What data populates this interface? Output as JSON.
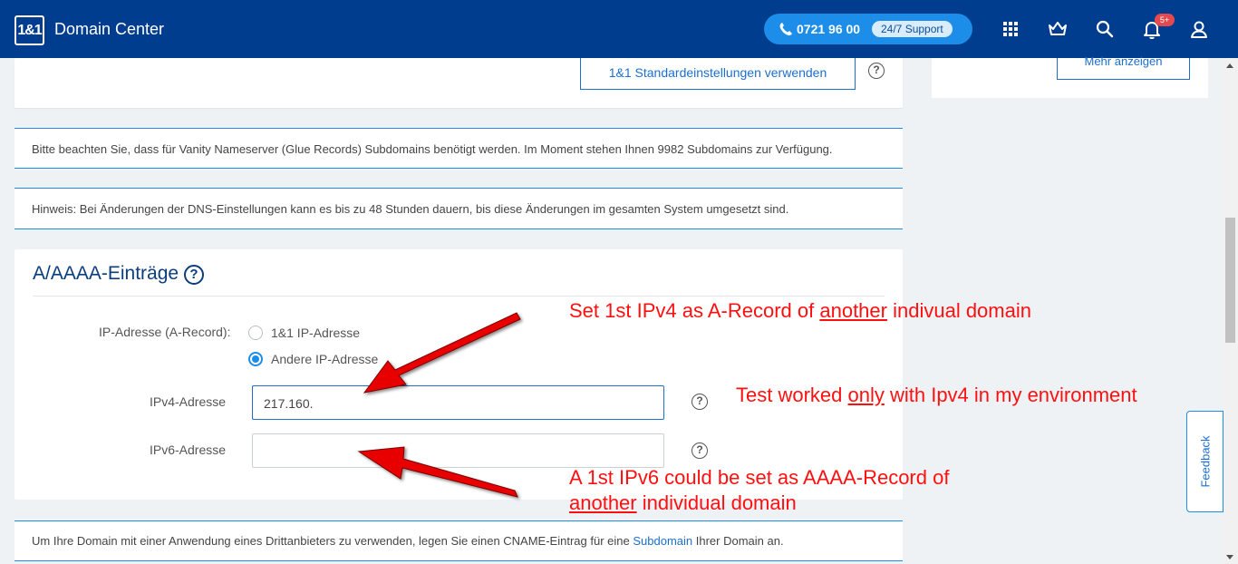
{
  "header": {
    "logo": "1&1",
    "title": "Domain Center",
    "phone": "0721 96 00",
    "support": "24/7 Support",
    "notifications_badge": "5+"
  },
  "top_card": {
    "default_settings_button": "1&1 Standardeinstellungen verwenden",
    "help": "?"
  },
  "side_card": {
    "more_button": "Mehr anzeigen"
  },
  "notices": {
    "glue": "Bitte beachten Sie, dass für Vanity Nameserver (Glue Records) Subdomains benötigt werden. Im Moment stehen Ihnen 9982 Subdomains zur Verfügung.",
    "dns_hint": "Hinweis: Bei Änderungen der DNS-Einstellungen kann es bis zu 48 Stunden dauern, bis diese Änderungen im gesamten System umgesetzt sind.",
    "cname_text": "Um Ihre Domain mit einer Anwendung eines Drittanbieters zu verwenden, legen Sie einen CNAME-Eintrag für eine",
    "cname_link": "Subdomain",
    "cname_suffix": "Ihrer Domain an."
  },
  "a_section": {
    "title": "A/AAAA-Einträge",
    "title_help": "?",
    "ip_label": "IP-Adresse (A-Record):",
    "radio_options": [
      {
        "label": "1&1 IP-Adresse",
        "selected": false
      },
      {
        "label": "Andere IP-Adresse",
        "selected": true
      }
    ],
    "ipv4_label": "IPv4-Adresse",
    "ipv4_value": "217.160.",
    "ipv6_label": "IPv6-Adresse",
    "ipv6_value": "",
    "help": "?"
  },
  "feedback": "Feedback",
  "annotations": {
    "a1_pre": "Set 1st IPv4 as A-Record of ",
    "a1_u": "another",
    "a1_post": " indivual domain",
    "a2_pre": "Test worked ",
    "a2_u": "only",
    "a2_post": " with Ipv4 in my environment",
    "a3_line1": "A 1st IPv6 could be set as AAAA-Record of",
    "a3_u": "another",
    "a3_post": " individual domain",
    "color": "#ff1010"
  },
  "colors": {
    "header_bg": "#003d8f",
    "accent": "#1c8de8",
    "link": "#1c6fd0",
    "heading": "#0a3e7e"
  }
}
